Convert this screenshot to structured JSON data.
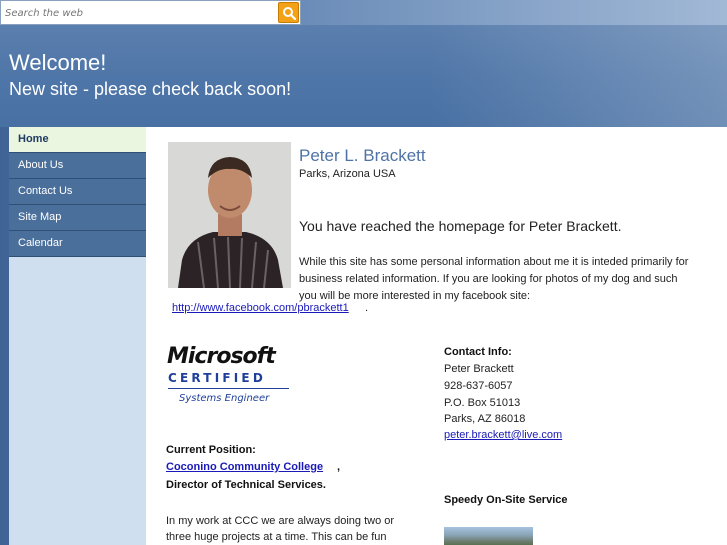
{
  "search": {
    "placeholder": "Search the web"
  },
  "header": {
    "title": "Welcome!",
    "subtitle": "New site - please check back soon!"
  },
  "sidebar": {
    "items": [
      {
        "label": "Home",
        "active": true
      },
      {
        "label": "About Us"
      },
      {
        "label": "Contact Us"
      },
      {
        "label": "Site Map"
      },
      {
        "label": "Calendar"
      }
    ]
  },
  "profile": {
    "name": "Peter L. Brackett",
    "location": "Parks, Arizona  USA",
    "greeting": "You have reached the homepage for Peter Brackett.",
    "intro": "While this site has some personal information about me it is inteded primarily for business related information. If you are looking for photos of my dog and such you will be more interested in my facebook site:",
    "facebook_link": "http://www.facebook.com/pbrackett1",
    "facebook_suffix": "."
  },
  "certification": {
    "brand": "Microsoft",
    "certified": "CERTIFIED",
    "track": "Systems Engineer"
  },
  "current_position": {
    "heading": "Current Position:",
    "employer": "Coconino Community College",
    "employer_suffix": ",",
    "role": "Director of Technical Services.",
    "description": "In my work at CCC we are always doing two or three huge projects at a time. This can be fun"
  },
  "contact": {
    "heading": "Contact Info:",
    "name": "Peter Brackett",
    "phone": "928-637-6057",
    "po_box": "P.O. Box 51013",
    "city": "Parks, AZ  86018",
    "email": "peter.brackett@live.com"
  },
  "service": {
    "heading": "Speedy On-Site Service"
  },
  "colors": {
    "header_bg": "#4f76a8",
    "nav_bg": "#4b6f9b",
    "nav_active_bg": "#eaf6df",
    "search_button": "#f3a217",
    "name_color": "#4f73a6",
    "link_color": "#1a1ab8"
  }
}
